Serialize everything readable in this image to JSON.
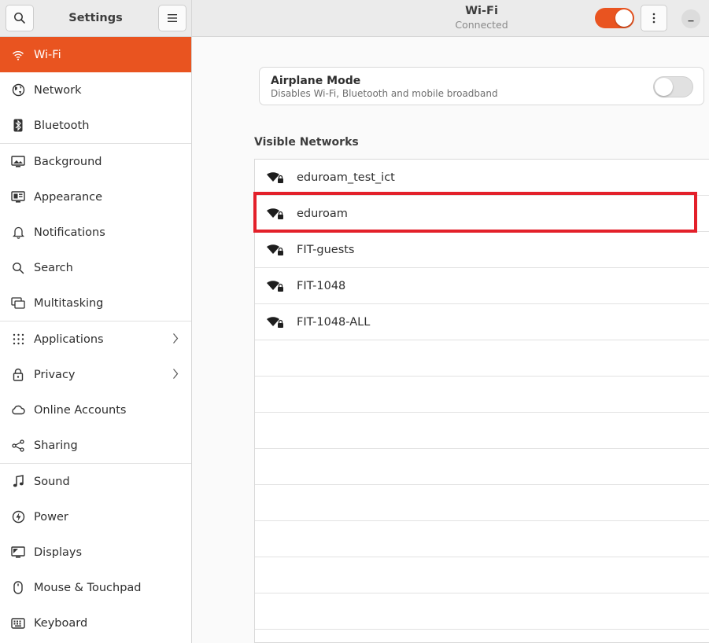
{
  "sidebar": {
    "title": "Settings",
    "items": [
      {
        "label": "Wi-Fi",
        "icon": "wifi-icon",
        "active": true
      },
      {
        "label": "Network",
        "icon": "globe-icon"
      },
      {
        "label": "Bluetooth",
        "icon": "bluetooth-icon"
      },
      {
        "label": "Background",
        "icon": "monitor-icon"
      },
      {
        "label": "Appearance",
        "icon": "appearance-icon"
      },
      {
        "label": "Notifications",
        "icon": "bell-icon"
      },
      {
        "label": "Search",
        "icon": "search-icon"
      },
      {
        "label": "Multitasking",
        "icon": "multitasking-icon"
      },
      {
        "label": "Applications",
        "icon": "grid-icon",
        "has_chevron": true
      },
      {
        "label": "Privacy",
        "icon": "lock-icon",
        "has_chevron": true
      },
      {
        "label": "Online Accounts",
        "icon": "cloud-icon"
      },
      {
        "label": "Sharing",
        "icon": "share-icon"
      },
      {
        "label": "Sound",
        "icon": "music-note-icon"
      },
      {
        "label": "Power",
        "icon": "power-icon"
      },
      {
        "label": "Displays",
        "icon": "display-icon"
      },
      {
        "label": "Mouse & Touchpad",
        "icon": "mouse-icon"
      },
      {
        "label": "Keyboard",
        "icon": "keyboard-icon"
      }
    ]
  },
  "header": {
    "title": "Wi-Fi",
    "subtitle": "Connected",
    "wifi_enabled": true
  },
  "airplane_mode": {
    "title": "Airplane Mode",
    "description": "Disables Wi-Fi, Bluetooth and mobile broadband",
    "enabled": false
  },
  "visible_networks": {
    "title": "Visible Networks",
    "networks": [
      {
        "ssid": "eduroam_test_ict",
        "secured": true
      },
      {
        "ssid": "eduroam",
        "secured": true,
        "highlighted": true
      },
      {
        "ssid": "FIT-guests",
        "secured": true
      },
      {
        "ssid": "FIT-1048",
        "secured": true
      },
      {
        "ssid": "FIT-1048-ALL",
        "secured": true
      }
    ]
  },
  "colors": {
    "accent": "#e95420",
    "highlight_box": "#e3202a"
  }
}
